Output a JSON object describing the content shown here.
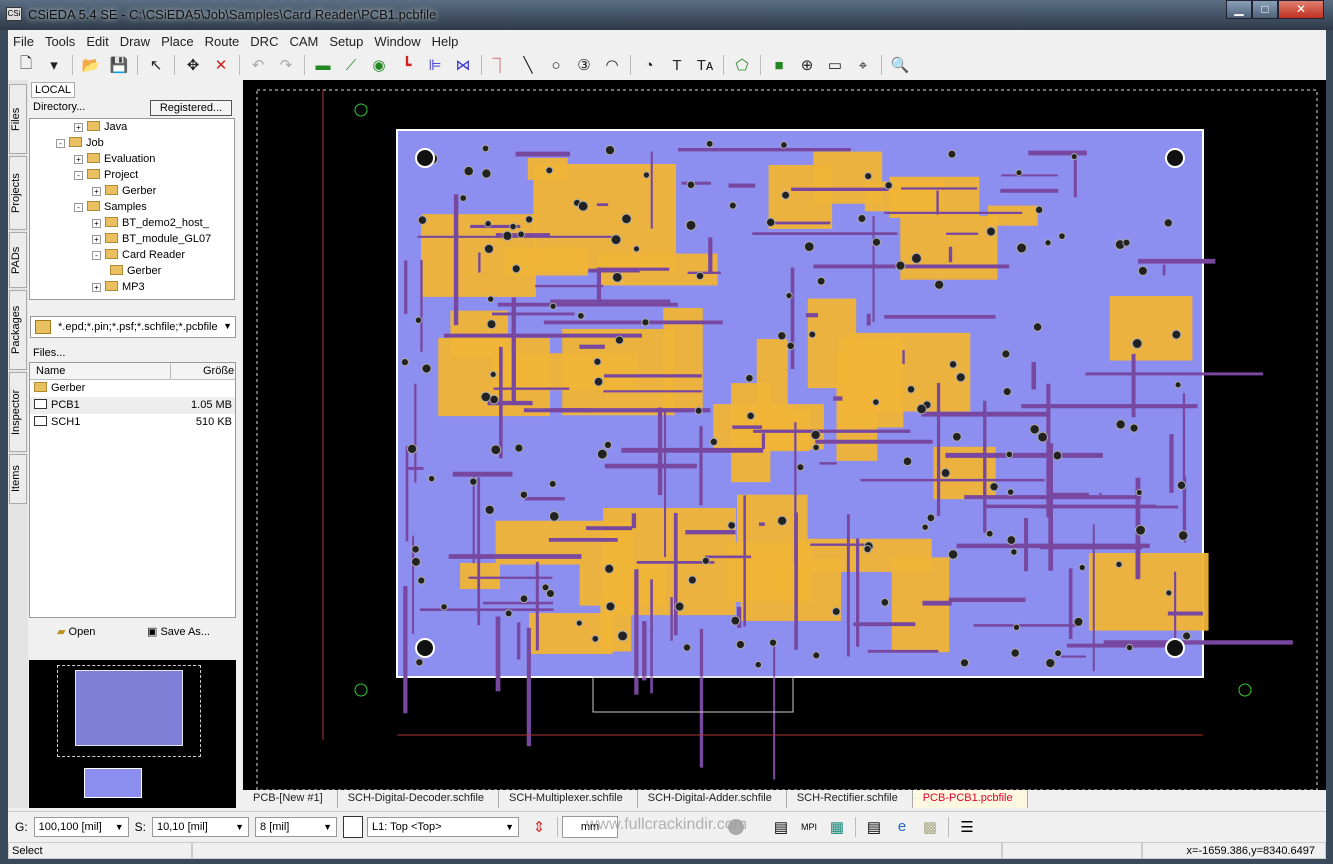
{
  "window": {
    "title": "CSiEDA 5.4 SE - C:\\CSiEDA5\\Job\\Samples\\Card Reader\\PCB1.pcbfile",
    "app_icon": "CSi",
    "minimize": "▁",
    "maximize": "□",
    "close": "✕"
  },
  "menu": [
    "File",
    "Tools",
    "Edit",
    "Draw",
    "Place",
    "Route",
    "DRC",
    "CAM",
    "Setup",
    "Window",
    "Help"
  ],
  "toolbar_icons": [
    "new-file",
    "dropdown",
    "open-folder",
    "save",
    "select-arrow",
    "move",
    "delete",
    "undo",
    "redo",
    "component",
    "connect",
    "via",
    "route",
    "align",
    "distribute",
    "trace",
    "line",
    "circle",
    "numbered-circle",
    "arc",
    "arc2",
    "text",
    "text-attr",
    "polygon",
    "fill-rect",
    "pad-cross",
    "dimension",
    "origin",
    "zoom-find"
  ],
  "left_panel": {
    "vertical_tabs": [
      "Files",
      "Projects",
      "PADs",
      "Packages",
      "Inspector",
      "Items"
    ],
    "location_tab": "LOCAL",
    "directory_label": "Directory...",
    "registered_button": "Registered...",
    "tree": [
      {
        "label": "Java",
        "depth": 2,
        "exp": "+"
      },
      {
        "label": "Job",
        "depth": 1,
        "exp": "-"
      },
      {
        "label": "Evaluation",
        "depth": 2,
        "exp": "+"
      },
      {
        "label": "Project",
        "depth": 2,
        "exp": "-"
      },
      {
        "label": "Gerber",
        "depth": 3,
        "exp": "+"
      },
      {
        "label": "Samples",
        "depth": 2,
        "exp": "-"
      },
      {
        "label": "BT_demo2_host_",
        "depth": 3,
        "exp": "+"
      },
      {
        "label": "BT_module_GL07",
        "depth": 3,
        "exp": "+"
      },
      {
        "label": "Card Reader",
        "depth": 3,
        "exp": "-"
      },
      {
        "label": "Gerber",
        "depth": 4,
        "exp": ""
      },
      {
        "label": "MP3",
        "depth": 3,
        "exp": "+"
      }
    ],
    "filter": "*.epd;*.pin;*.psf;*.schfile;*.pcbfile",
    "files_label": "Files...",
    "columns": [
      "Name",
      "Größe"
    ],
    "files": [
      {
        "name": "Gerber",
        "size": "",
        "type": "folder"
      },
      {
        "name": "PCB1",
        "size": "1.05 MB",
        "type": "pcb"
      },
      {
        "name": "SCH1",
        "size": "510 KB",
        "type": "sch"
      }
    ],
    "open_button": "Open",
    "save_as_button": "Save As..."
  },
  "doc_tabs": [
    "PCB-[New #1]",
    "SCH-Digital-Decoder.schfile",
    "SCH-Multiplexer.schfile",
    "SCH-Digital-Adder.schfile",
    "SCH-Rectifier.schfile",
    "PCB-PCB1.pcbfile"
  ],
  "active_tab": 5,
  "bottom": {
    "g_label": "G:",
    "grid": "100,100 [mil]",
    "s_label": "S:",
    "snap": "10,10 [mil]",
    "width": "8 [mil]",
    "layer": "L1: Top <Top>",
    "unit": "mm",
    "watermark": "www.fullcrackindir.com"
  },
  "status": {
    "mode": "Select",
    "coords": "x=-1659.386,y=8340.6497"
  },
  "colors": {
    "board": "#8c8ef0",
    "copper": "#f0b436",
    "trace": "#7848a0",
    "canvas": "#000000",
    "active_tab": "#e0002a"
  }
}
